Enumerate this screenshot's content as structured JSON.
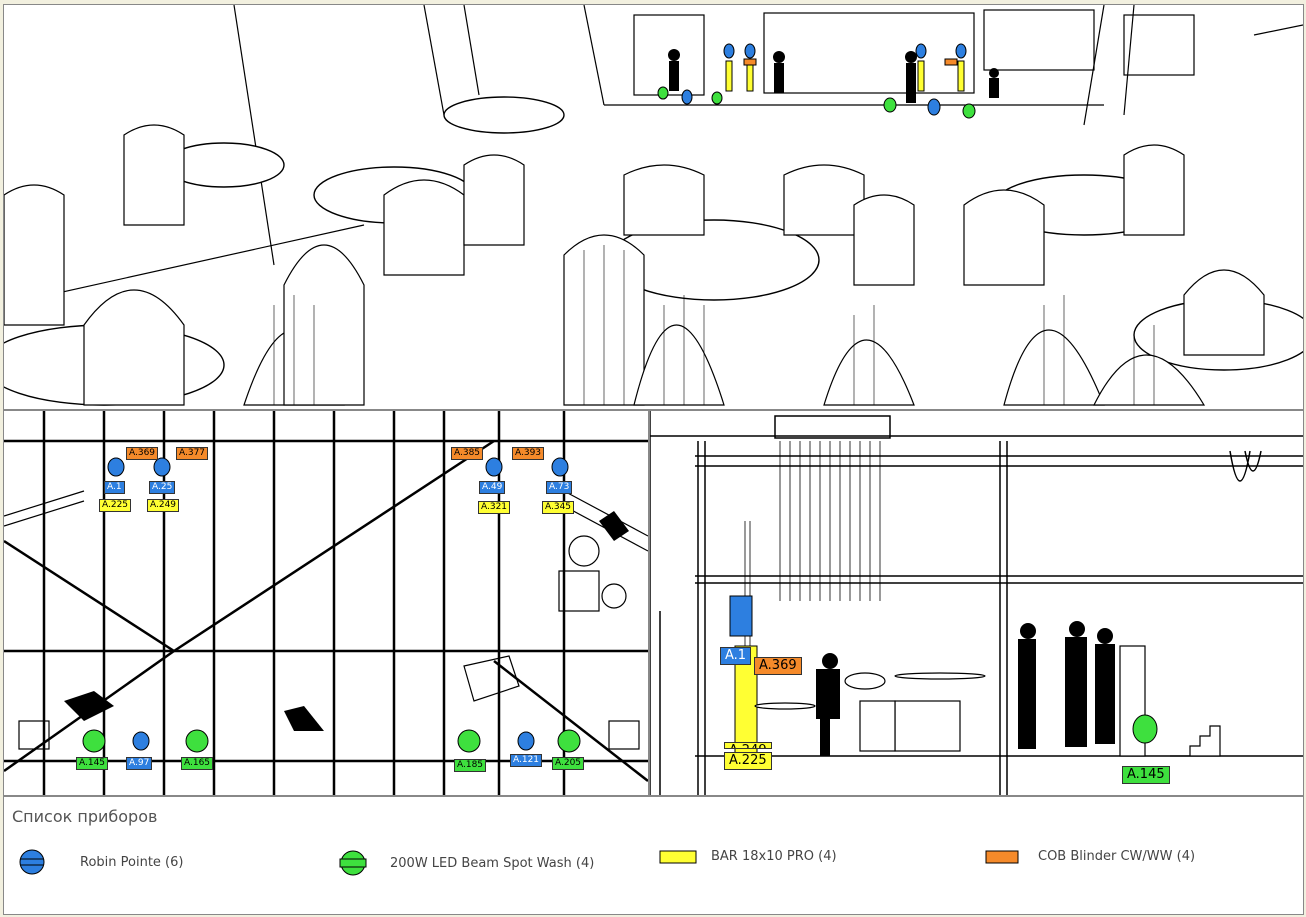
{
  "viewports": {
    "top_tags": [
      {
        "text": "A.369",
        "kind": "orange"
      },
      {
        "text": "A.377",
        "kind": "orange"
      },
      {
        "text": "A.1",
        "kind": "blue"
      },
      {
        "text": "A.25",
        "kind": "blue"
      },
      {
        "text": "A.225",
        "kind": "yellow"
      },
      {
        "text": "A.249",
        "kind": "yellow"
      },
      {
        "text": "A.385",
        "kind": "orange"
      },
      {
        "text": "A.393",
        "kind": "orange"
      },
      {
        "text": "A.49",
        "kind": "blue"
      },
      {
        "text": "A.73",
        "kind": "blue"
      },
      {
        "text": "A.321",
        "kind": "yellow"
      },
      {
        "text": "A.345",
        "kind": "yellow"
      },
      {
        "text": "A.145",
        "kind": "green"
      },
      {
        "text": "A.97",
        "kind": "blue"
      },
      {
        "text": "A.165",
        "kind": "green"
      },
      {
        "text": "A.185",
        "kind": "green"
      },
      {
        "text": "A.121",
        "kind": "blue"
      },
      {
        "text": "A.205",
        "kind": "green"
      }
    ],
    "front_tags": [
      {
        "text": "A.1",
        "kind": "blue"
      },
      {
        "text": "A.369",
        "kind": "orange"
      },
      {
        "text": "A.249",
        "kind": "yellow"
      },
      {
        "text": "A.225",
        "kind": "yellow"
      },
      {
        "text": "A.145",
        "kind": "green"
      }
    ]
  },
  "legend": {
    "title": "Список приборов",
    "items": [
      {
        "icon": "robin-pointe-icon",
        "color": "#2d7fe0",
        "label": "Robin Pointe (6)"
      },
      {
        "icon": "led-beam-spot-wash-icon",
        "color": "#3ee03e",
        "label": "200W LED Beam Spot Wash (4)"
      },
      {
        "icon": "bar-icon",
        "color": "#ffff33",
        "label": "BAR 18x10 PRO (4)"
      },
      {
        "icon": "cob-blinder-icon",
        "color": "#f58a2a",
        "label": "COB Blinder CW/WW (4)"
      }
    ]
  }
}
